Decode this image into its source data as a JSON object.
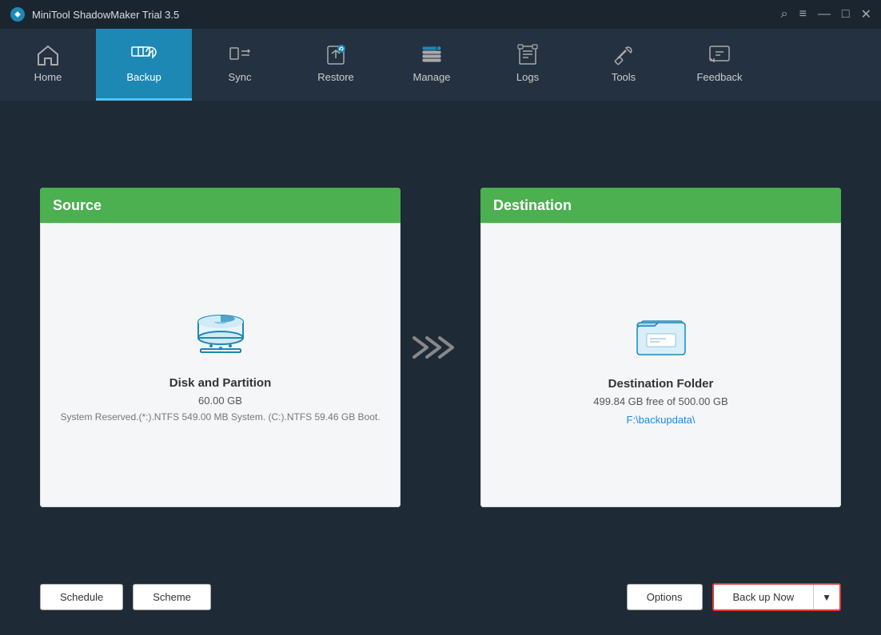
{
  "titleBar": {
    "logo": "M",
    "title": "MiniTool ShadowMaker Trial 3.5",
    "searchIcon": "⌕",
    "menuIcon": "≡",
    "minimizeIcon": "—",
    "maximizeIcon": "□",
    "closeIcon": "✕"
  },
  "nav": {
    "items": [
      {
        "id": "home",
        "label": "Home",
        "icon": "home"
      },
      {
        "id": "backup",
        "label": "Backup",
        "icon": "backup",
        "active": true
      },
      {
        "id": "sync",
        "label": "Sync",
        "icon": "sync"
      },
      {
        "id": "restore",
        "label": "Restore",
        "icon": "restore"
      },
      {
        "id": "manage",
        "label": "Manage",
        "icon": "manage"
      },
      {
        "id": "logs",
        "label": "Logs",
        "icon": "logs"
      },
      {
        "id": "tools",
        "label": "Tools",
        "icon": "tools"
      },
      {
        "id": "feedback",
        "label": "Feedback",
        "icon": "feedback"
      }
    ]
  },
  "source": {
    "headerLabel": "Source",
    "title": "Disk and Partition",
    "size": "60.00 GB",
    "detail": "System Reserved.(*:).NTFS 549.00 MB System. (C:).NTFS 59.46 GB Boot."
  },
  "destination": {
    "headerLabel": "Destination",
    "title": "Destination Folder",
    "freeSpace": "499.84 GB free of 500.00 GB",
    "path": "F:\\backupdata\\"
  },
  "bottomToolbar": {
    "scheduleLabel": "Schedule",
    "schemeLabel": "Scheme",
    "optionsLabel": "Options",
    "backupNowLabel": "Back up Now"
  }
}
